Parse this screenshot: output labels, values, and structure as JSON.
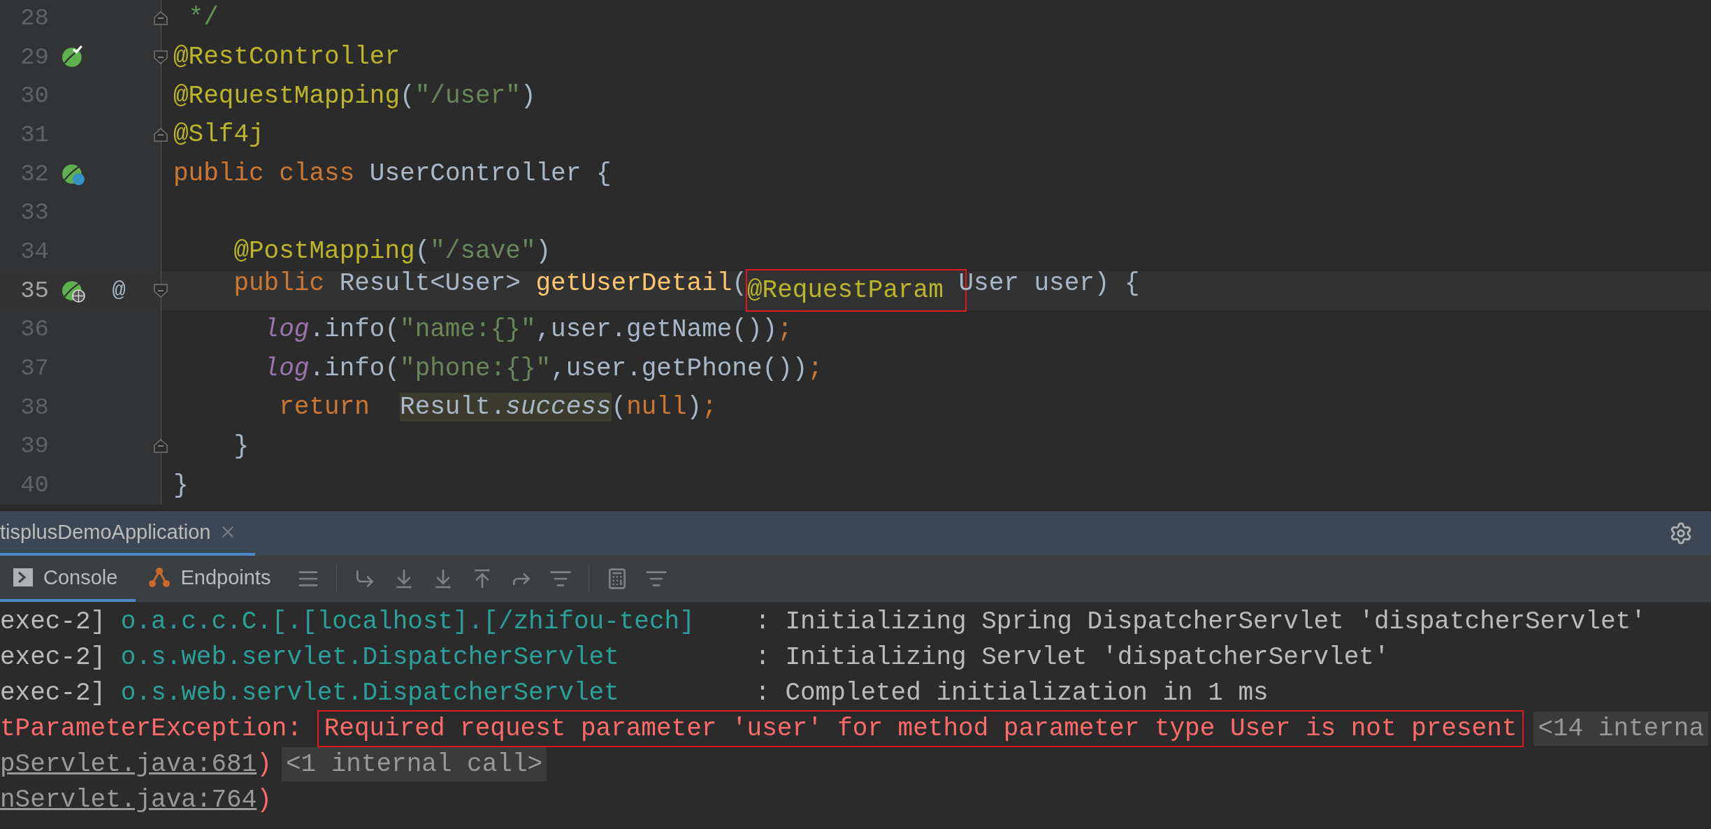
{
  "editor": {
    "lines": [
      {
        "number": "28",
        "fold_marker": {
          "kind": "end"
        },
        "tokens": [
          {
            "text": " */",
            "kind": "comment"
          }
        ]
      },
      {
        "number": "29",
        "gutter_icon": {
          "kind": "bean-check"
        },
        "fold_marker": {
          "kind": "start"
        },
        "tokens": [
          {
            "text": "@RestController",
            "kind": "annotation"
          }
        ]
      },
      {
        "number": "30",
        "tokens": [
          {
            "text": "@RequestMapping",
            "kind": "annotation"
          },
          {
            "text": "(",
            "kind": "plain"
          },
          {
            "text": "\"/user\"",
            "kind": "string"
          },
          {
            "text": ")",
            "kind": "plain"
          }
        ]
      },
      {
        "number": "31",
        "fold_marker": {
          "kind": "end"
        },
        "tokens": [
          {
            "text": "@Slf4j",
            "kind": "annotation"
          }
        ]
      },
      {
        "number": "32",
        "gutter_icon": {
          "kind": "bean-class"
        },
        "tokens": [
          {
            "text": "public class ",
            "kind": "keyword"
          },
          {
            "text": "UserController {",
            "kind": "plain"
          }
        ]
      },
      {
        "number": "33"
      },
      {
        "number": "34",
        "tokens": [
          {
            "text": "    @PostMapping",
            "kind": "annotation"
          },
          {
            "text": "(",
            "kind": "plain"
          },
          {
            "text": "\"/save\"",
            "kind": "string"
          },
          {
            "text": ")",
            "kind": "plain"
          }
        ]
      },
      {
        "number": "35",
        "gutter_icon": {
          "kind": "bean-web"
        },
        "at": "@",
        "fold_marker": {
          "kind": "start"
        },
        "current": true,
        "tokens": [
          {
            "text": "    public ",
            "kind": "keyword"
          },
          {
            "text": "Result<User> ",
            "kind": "plain"
          },
          {
            "text": "getUserDetail",
            "kind": "method"
          },
          {
            "text": "(",
            "kind": "plain"
          },
          {
            "text": "@RequestParam ",
            "kind": "annotation",
            "marked": true
          },
          {
            "text": "User user) {",
            "kind": "plain"
          }
        ]
      },
      {
        "number": "36",
        "tokens": [
          {
            "text": "      log",
            "kind": "field"
          },
          {
            "text": ".info(",
            "kind": "plain"
          },
          {
            "text": "\"name:{}\"",
            "kind": "string"
          },
          {
            "text": ",user.getName())",
            "kind": "plain"
          },
          {
            "text": ";",
            "kind": "keyword"
          }
        ]
      },
      {
        "number": "37",
        "tokens": [
          {
            "text": "      log",
            "kind": "field"
          },
          {
            "text": ".info(",
            "kind": "plain"
          },
          {
            "text": "\"phone:{}\"",
            "kind": "string"
          },
          {
            "text": ",user.getPhone())",
            "kind": "plain"
          },
          {
            "text": ";",
            "kind": "keyword"
          }
        ]
      },
      {
        "number": "38",
        "tokens": [
          {
            "text": "       return  ",
            "kind": "keyword"
          },
          {
            "text": "Result.",
            "kind": "plain",
            "highlighted": true
          },
          {
            "text": "success",
            "kind": "static",
            "highlighted": true
          },
          {
            "text": "(",
            "kind": "plain"
          },
          {
            "text": "null",
            "kind": "keyword"
          },
          {
            "text": ")",
            "kind": "plain"
          },
          {
            "text": ";",
            "kind": "keyword"
          }
        ]
      },
      {
        "number": "39",
        "fold_marker": {
          "kind": "end"
        },
        "tokens": [
          {
            "text": "    }",
            "kind": "plain"
          }
        ]
      },
      {
        "number": "40",
        "tokens": [
          {
            "text": "}",
            "kind": "plain"
          }
        ]
      }
    ]
  },
  "run_tabs": [
    {
      "label": "tisplusDemoApplication",
      "selected": true
    }
  ],
  "tool_tabs": [
    {
      "label": "Console",
      "selected": true
    },
    {
      "label": "Endpoints",
      "selected": false
    }
  ],
  "console": {
    "lines": [
      [
        {
          "text": "exec-2] ",
          "kind": "plain"
        },
        {
          "text": "o.a.c.c.C.[.[localhost].[/zhifou-tech]",
          "kind": "logger"
        },
        {
          "text": "    : Initializing Spring DispatcherServlet 'dispatcherServlet'",
          "kind": "plain"
        }
      ],
      [
        {
          "text": "exec-2] ",
          "kind": "plain"
        },
        {
          "text": "o.s.web.servlet.DispatcherServlet",
          "kind": "logger"
        },
        {
          "text": "         : Initializing Servlet 'dispatcherServlet'",
          "kind": "plain"
        }
      ],
      [
        {
          "text": "exec-2] ",
          "kind": "plain"
        },
        {
          "text": "o.s.web.servlet.DispatcherServlet",
          "kind": "logger"
        },
        {
          "text": "         : Completed initialization in 1 ms",
          "kind": "plain"
        }
      ],
      [
        {
          "text": "tParameterException: ",
          "kind": "error"
        },
        {
          "text": "Required request parameter 'user' for method parameter type User is not present",
          "kind": "error",
          "marked": true
        },
        {
          "text": "<14 interna",
          "kind": "folded"
        }
      ],
      [
        {
          "text": "pServlet.java:681",
          "kind": "link"
        },
        {
          "text": ")",
          "kind": "error"
        },
        {
          "text": "<1 internal call>",
          "kind": "folded"
        }
      ],
      [
        {
          "text": "nServlet.java:764",
          "kind": "link"
        },
        {
          "text": ")",
          "kind": "error"
        }
      ]
    ]
  }
}
